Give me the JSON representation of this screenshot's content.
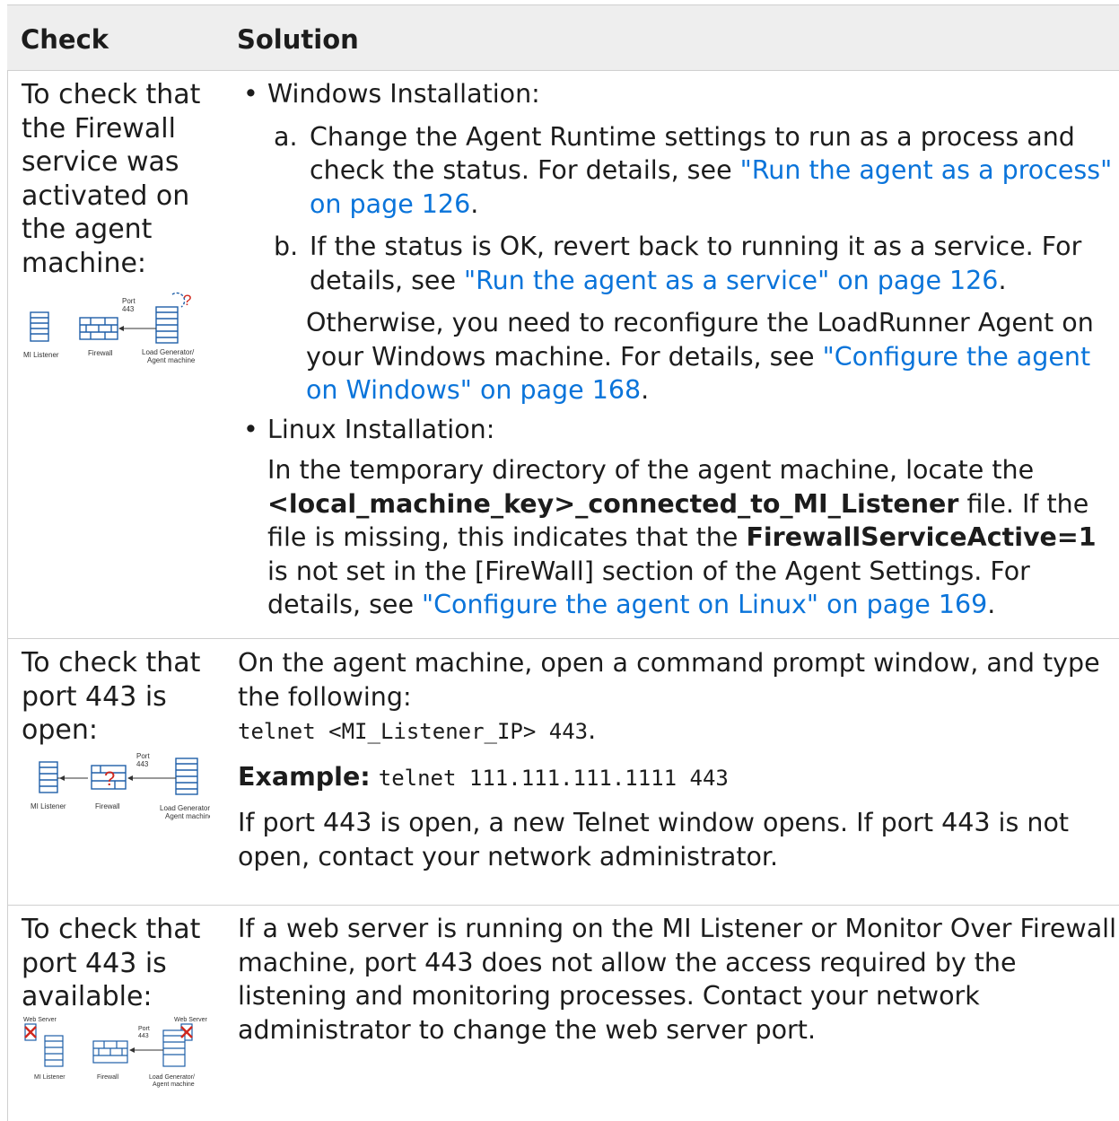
{
  "header": {
    "check": "Check",
    "solution": "Solution"
  },
  "rows": [
    {
      "check": "To check that the Firewall service was activated on the agent machine:",
      "diagram": {
        "port": "Port",
        "port_num": "443",
        "mi": "MI Listener",
        "fw": "Firewall",
        "lg1": "Load Generator/",
        "lg2": "Agent machine",
        "q": "?"
      },
      "win_bullet": "Windows Installation:",
      "win_a_letter": "a.",
      "win_a_text": "Change the Agent Runtime settings to run as a process and check the status. For details, see ",
      "win_a_link": "\"Run the agent as a process\" on page 126",
      "win_b_letter": "b.",
      "win_b_text": "If the status is OK, revert back to running it as a service. For details, see ",
      "win_b_link": "\"Run the agent as a service\" on page 126",
      "win_other_text": "Otherwise, you need to reconfigure the LoadRunner Agent on your Windows machine. For details, see ",
      "win_other_link": "\"Configure the agent on Windows\" on page 168",
      "linux_bullet": "Linux Installation:",
      "linux_t1": "In the temporary directory of the agent machine, locate the ",
      "linux_b1": "<local_machine_key>_connected_to_MI_Listener",
      "linux_t2": " file. If the file is missing, this indicates that the ",
      "linux_b2": "FirewallServiceActive=1",
      "linux_t3": " is not set in the [FireWall] section of the Agent Settings. For details, see ",
      "linux_link": "\"Configure the agent on Linux\" on page 169",
      "dot": "."
    },
    {
      "check": "To check that port 443 is open:",
      "diagram": {
        "port": "Port",
        "port_num": "443",
        "mi": "MI Listener",
        "fw": "Firewall",
        "lg1": "Load Generator/",
        "lg2": "Agent machine",
        "q": "?"
      },
      "p1": "On the agent machine, open a command prompt window, and type the following:",
      "cmd": "telnet <MI_Listener_IP> 443",
      "dot": ".",
      "example_label": "Example:",
      "example_cmd": "telnet 111.111.111.1111 443",
      "p3": "If port 443 is open, a new Telnet window opens. If port 443 is not open, contact your network administrator."
    },
    {
      "check": "To check that port 443 is available:",
      "diagram": {
        "ws1": "Web Server",
        "ws2": "Web Server",
        "port": "Port",
        "port_num": "443",
        "mi": "MI Listener",
        "fw": "Firewall",
        "lg1": "Load Generator/",
        "lg2": "Agent machine"
      },
      "p1": "If a web server is running on the MI Listener or Monitor Over Firewall machine, port 443 does not allow the access required by the listening and monitoring processes. Contact your network administrator to change the web server port."
    }
  ],
  "colors": {
    "link": "#0a74da",
    "header_bg": "#eeeeee",
    "diagram_blue": "#1f5fa8",
    "question_red": "#d0281e"
  }
}
